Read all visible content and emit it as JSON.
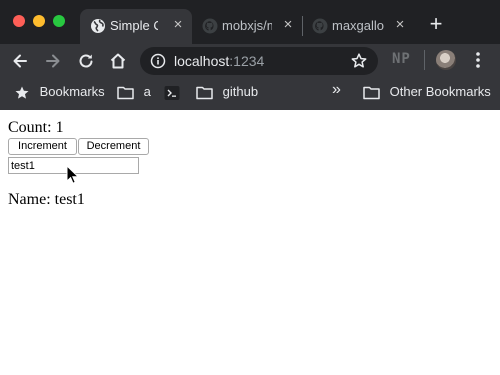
{
  "browser": {
    "tabs": [
      {
        "title": "Simple Counter",
        "icon": "globe-icon",
        "active": true
      },
      {
        "title": "mobxjs/mobx",
        "icon": "github-icon",
        "active": false
      },
      {
        "title": "maxgallo/mobx",
        "icon": "github-icon",
        "active": false
      }
    ],
    "new_tab_label": "+",
    "address": {
      "host": "localhost",
      "port": ":1234"
    },
    "extension_label": "NP",
    "bookmarks": [
      {
        "label": "Bookmarks",
        "icon": "star-icon"
      },
      {
        "label": "a",
        "icon": "folder-icon"
      },
      {
        "label": "",
        "icon": "terminal-icon"
      },
      {
        "label": "github",
        "icon": "folder-icon"
      }
    ],
    "overflow_label": "»",
    "other_bookmarks": "Other Bookmarks"
  },
  "page": {
    "count_text": "Count: 1",
    "increment_label": "Increment",
    "decrement_label": "Decrement",
    "name_input_value": "test1",
    "name_text": "Name: test1"
  },
  "colors": {
    "frame": "#202124",
    "toolbar": "#35363a",
    "close_red": "#fe5f57",
    "minimize_yellow": "#febc2e",
    "zoom_green": "#28c840"
  }
}
